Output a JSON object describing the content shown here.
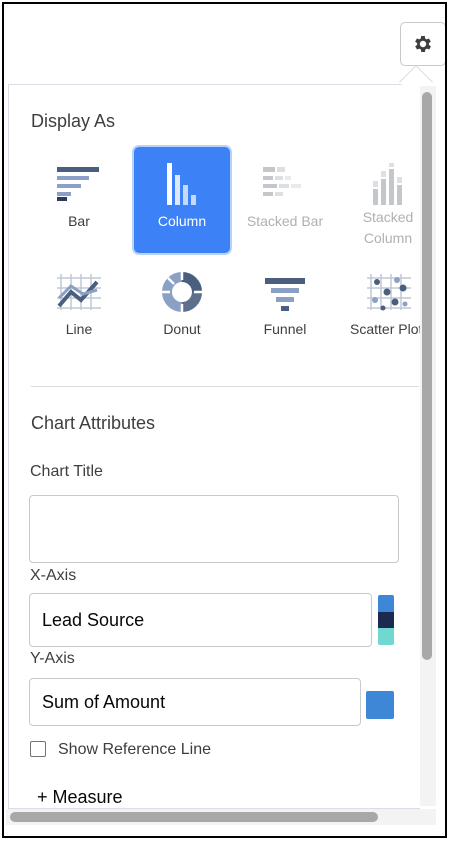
{
  "display_as": {
    "title": "Display As",
    "chart_types": [
      {
        "label": "Bar",
        "icon": "bar-chart-icon",
        "state": "normal"
      },
      {
        "label": "Column",
        "icon": "column-chart-icon",
        "state": "selected"
      },
      {
        "label": "Stacked Bar",
        "icon": "stacked-bar-chart-icon",
        "state": "disabled"
      },
      {
        "label": "Stacked Column",
        "icon": "stacked-column-chart-icon",
        "state": "disabled"
      },
      {
        "label": "Line",
        "icon": "line-chart-icon",
        "state": "normal"
      },
      {
        "label": "Donut",
        "icon": "donut-chart-icon",
        "state": "normal"
      },
      {
        "label": "Funnel",
        "icon": "funnel-chart-icon",
        "state": "normal"
      },
      {
        "label": "Scatter Plot",
        "icon": "scatter-plot-icon",
        "state": "normal"
      }
    ]
  },
  "chart_attributes": {
    "title": "Chart Attributes",
    "chart_title_label": "Chart Title",
    "chart_title_value": "",
    "x_axis_label": "X-Axis",
    "x_axis_value": "Lead Source",
    "x_axis_colors": [
      "#3d87d6",
      "#1b2a4e",
      "#6fd9d0"
    ],
    "y_axis_label": "Y-Axis",
    "y_axis_value": "Sum of Amount",
    "y_axis_color": "#3d87d6",
    "reference_line_label": "Show Reference Line",
    "reference_line_checked": false,
    "add_measure_label": "+ Measure"
  },
  "colors": {
    "selected_bg": "#3c82f6",
    "icon_dark": "#4a5f7d",
    "icon_disabled": "#c3c7cc"
  }
}
